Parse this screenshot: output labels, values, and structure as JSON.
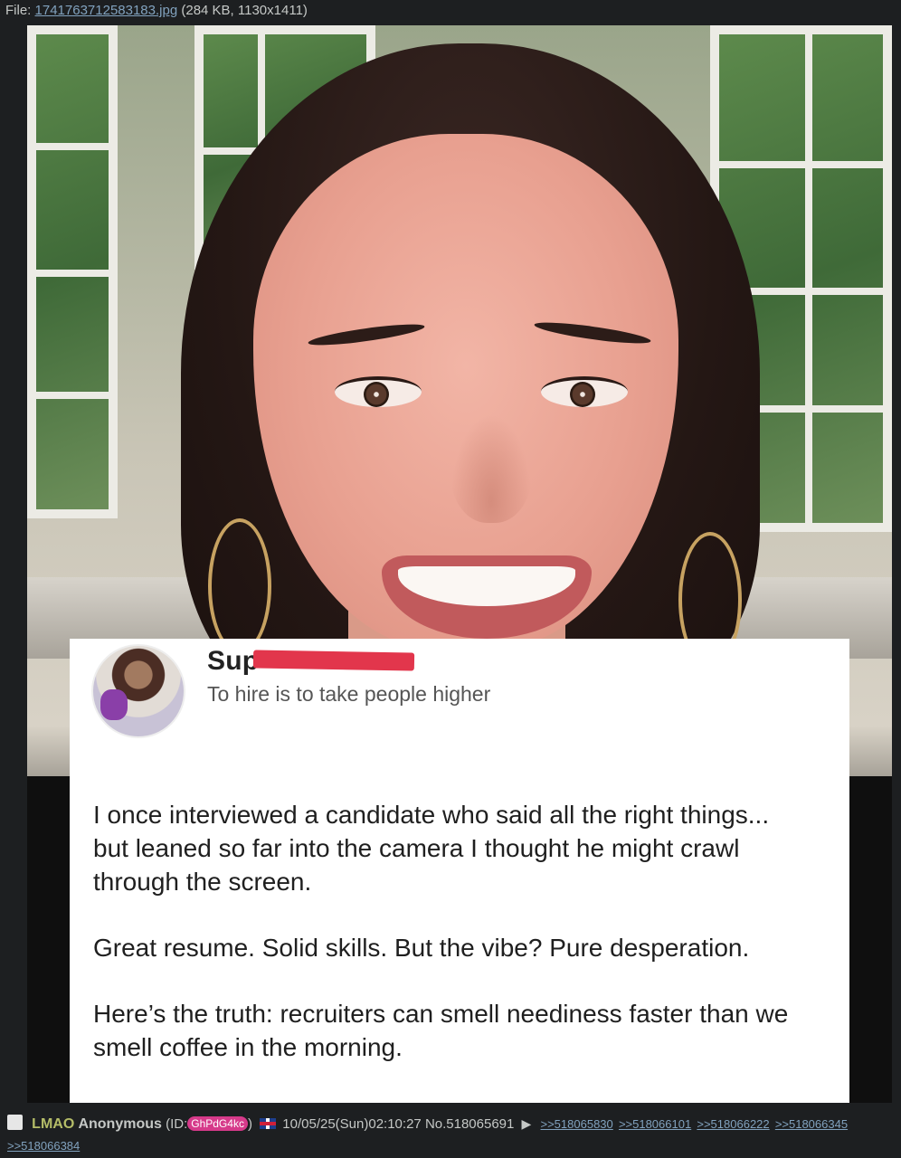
{
  "file": {
    "label": "File:",
    "filename": "1741763712583183.jpg",
    "meta": "(284 KB, 1130x1411)"
  },
  "card": {
    "author_visible": "Sup",
    "tagline": "To hire is to take people higher",
    "paragraphs": [
      "I once interviewed a candidate who said all the right things... but leaned so far into the camera I thought he might crawl through the screen.",
      "Great resume. Solid skills. But the vibe? Pure desperation.",
      "Here’s the truth: recruiters can smell neediness faster than we smell coffee in the morning."
    ]
  },
  "post": {
    "subject": "LMAO",
    "name": "Anonymous",
    "id_prefix": "(ID:",
    "poster_id": "GhPdG4kc",
    "id_suffix": ")",
    "datetime": "10/05/25(Sun)02:10:27",
    "number": "No.518065691",
    "arrow": "▶",
    "backlinks": [
      ">>518065830",
      ">>518066101",
      ">>518066222",
      ">>518066345",
      ">>518066384"
    ]
  },
  "colors": {
    "background": "#1d1f21",
    "link": "#81a2be",
    "subject": "#b5bd68",
    "id_badge": "#d63a8a",
    "redaction": "#e2364c"
  }
}
